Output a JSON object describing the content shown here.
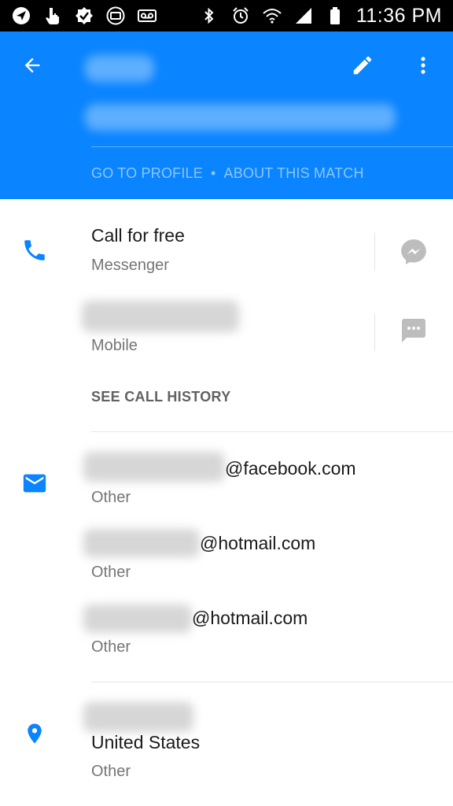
{
  "status_bar": {
    "time": "11:36 PM",
    "left_icons": [
      "navigation-icon",
      "hand-pointer-icon",
      "check-badge-icon",
      "contact-card-icon",
      "voicemail-icon"
    ],
    "right_icons": [
      "bluetooth-icon",
      "alarm-icon",
      "wifi-icon",
      "signal-icon",
      "battery-icon"
    ]
  },
  "header": {
    "links": {
      "go_to_profile": "GO TO PROFILE",
      "separator": "•",
      "about_match": "ABOUT THIS MATCH"
    },
    "accent_color": "#0A84FF"
  },
  "phone_section": {
    "items": [
      {
        "primary": "Call for free",
        "secondary": "Messenger",
        "action_icon": "messenger-icon"
      },
      {
        "primary": "",
        "secondary": "Mobile",
        "action_icon": "sms-message-icon"
      }
    ],
    "see_call_history": "SEE CALL HISTORY"
  },
  "email_section": {
    "items": [
      {
        "domain": "@facebook.com",
        "label": "Other"
      },
      {
        "domain": "@hotmail.com",
        "label": "Other"
      },
      {
        "domain": "@hotmail.com",
        "label": "Other"
      }
    ]
  },
  "address_section": {
    "country": "United States",
    "label": "Other"
  }
}
